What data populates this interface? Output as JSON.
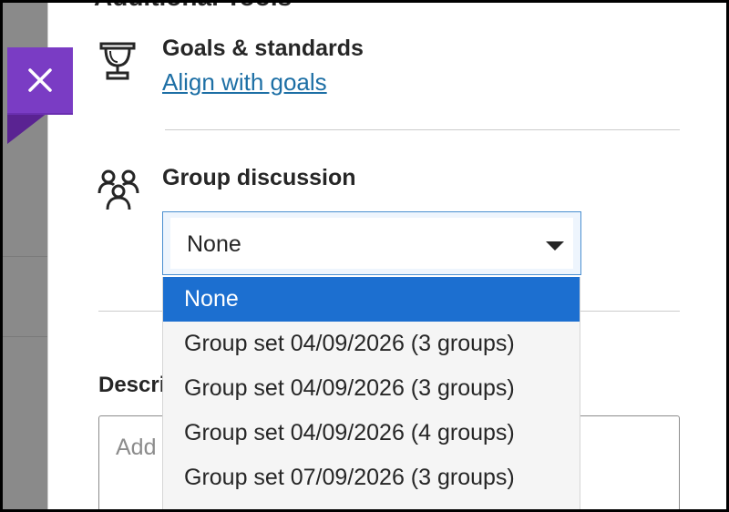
{
  "header": {
    "clipped_title": "Additional Tools"
  },
  "close_button": {
    "label": "×",
    "icon": "close-icon",
    "color": "#7a3cc4"
  },
  "goals": {
    "icon": "trophy-icon",
    "title": "Goals & standards",
    "link": "Align with goals"
  },
  "group_discussion": {
    "icon": "group-icon",
    "title": "Group discussion",
    "select_value": "None",
    "options": [
      "None",
      "Group set 04/09/2026 (3 groups)",
      "Group set 04/09/2026 (3 groups)",
      "Group set 04/09/2026 (4 groups)",
      "Group set 07/09/2026 (3 groups)"
    ],
    "selected_index": 0
  },
  "description": {
    "label": "Description",
    "placeholder": "Add a description"
  },
  "colors": {
    "accent": "#1c6fd0",
    "link": "#1d6fa5",
    "close_tab": "#7a3cc4"
  }
}
